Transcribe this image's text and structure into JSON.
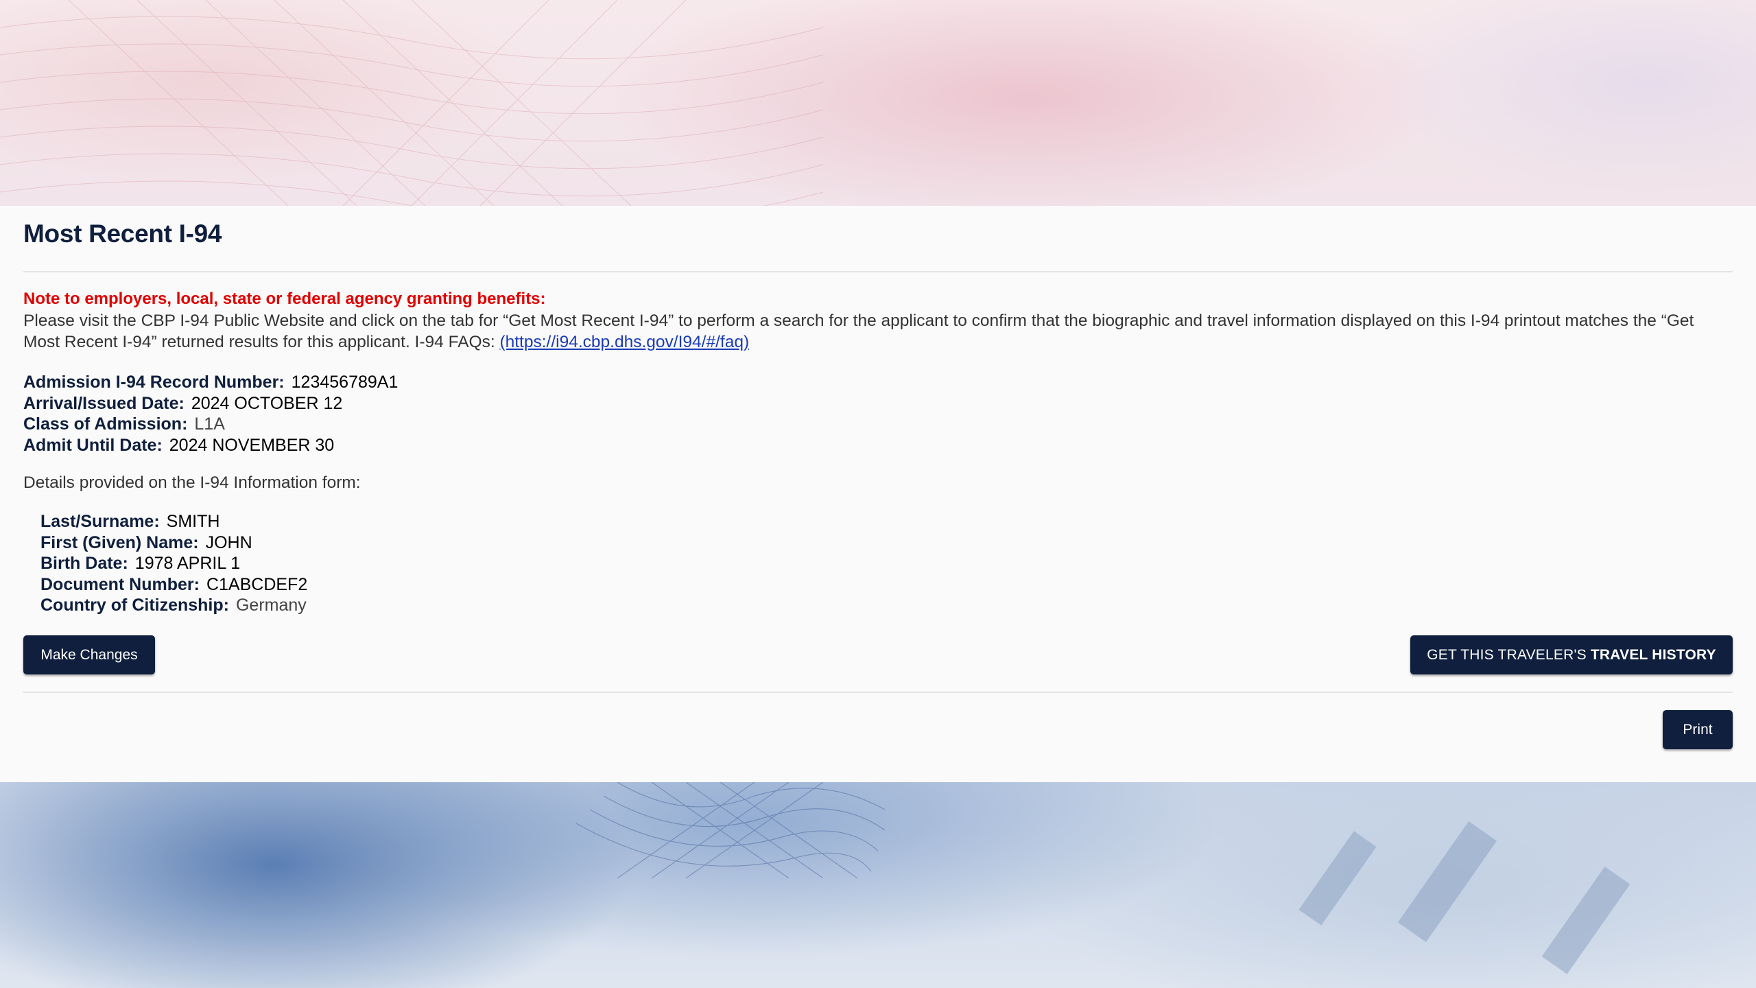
{
  "page": {
    "title": "Most Recent I-94"
  },
  "notice": {
    "heading": "Note to employers, local, state or federal agency granting benefits:",
    "body": "Please visit the CBP I-94 Public Website and click on the tab for “Get Most Recent I-94” to perform a search for the applicant to confirm that the biographic and travel information displayed on this I-94 printout matches the “Get Most Recent I-94” returned results for this applicant. I-94 FAQs: ",
    "faq_link": "(https://i94.cbp.dhs.gov/I94/#/faq)"
  },
  "record": {
    "admission_number_label": "Admission I-94 Record Number:",
    "admission_number": "123456789A1",
    "arrival_date_label": "Arrival/Issued Date:",
    "arrival_date": "2024 OCTOBER 12",
    "class_label": "Class of Admission:",
    "class_value": "L1A",
    "admit_until_label": "Admit Until Date:",
    "admit_until": "2024 NOVEMBER 30"
  },
  "details": {
    "heading": "Details provided on the I-94 Information form:",
    "surname_label": "Last/Surname:",
    "surname": "SMITH",
    "given_name_label": "First (Given) Name:",
    "given_name": "JOHN",
    "birth_date_label": "Birth Date:",
    "birth_date": "1978 APRIL 1",
    "document_label": "Document Number:",
    "document_number": "C1ABCDEF2",
    "citizenship_label": "Country of Citizenship:",
    "citizenship": "Germany"
  },
  "buttons": {
    "make_changes": "Make Changes",
    "travel_history_prefix": "GET THIS TRAVELER'S ",
    "travel_history_bold": "TRAVEL HISTORY",
    "print": "Print"
  },
  "colors": {
    "navy": "#0f1f3d",
    "notice_red": "#e00000",
    "link_blue": "#1a3bb8"
  }
}
